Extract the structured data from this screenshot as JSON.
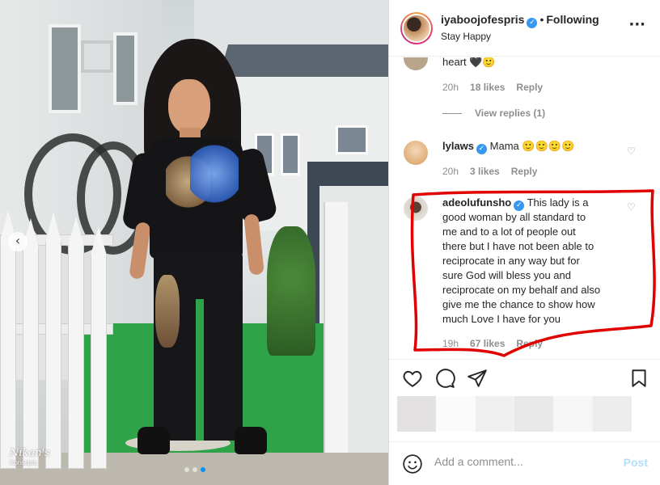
{
  "photo": {
    "watermark_main": "Nikan's",
    "watermark_sub": "Konsepts",
    "carousel_prev_icon": "chevron-left-icon",
    "carousel_dots": 3,
    "carousel_active_index": 2
  },
  "header": {
    "username": "iyaboojofespris",
    "verified_icon": "verified-badge-icon",
    "separator": "•",
    "follow_status": "Following",
    "subtitle": "Stay Happy",
    "more_icon": "more-options-icon"
  },
  "comments": [
    {
      "text": "heart 🖤🙂",
      "time": "20h",
      "likes": "18 likes",
      "reply": "Reply",
      "view_replies": "View replies (1)"
    },
    {
      "username": "lylaws",
      "text": "Mama 🙂🙂🙂🙂",
      "time": "20h",
      "likes": "3 likes",
      "reply": "Reply"
    },
    {
      "username": "adeolufunsho",
      "lines": [
        "good woman by all standard to",
        "me and to a lot of people out",
        "there but I have not been able to",
        "reciprocate in any way but for",
        "sure God will bless you and",
        "reciprocate on my behalf and also",
        "give me the chance to show how",
        "much Love I have for you"
      ],
      "first_line": "This lady is a",
      "time": "19h",
      "likes": "67 likes",
      "reply": "Reply"
    }
  ],
  "add_comment": {
    "placeholder": "Add a comment...",
    "post_label": "Post"
  },
  "colors": {
    "verified": "#3897f0",
    "highlight": "#e00000",
    "post_disabled": "#b2dffc",
    "carousel_active": "#0095f6"
  }
}
